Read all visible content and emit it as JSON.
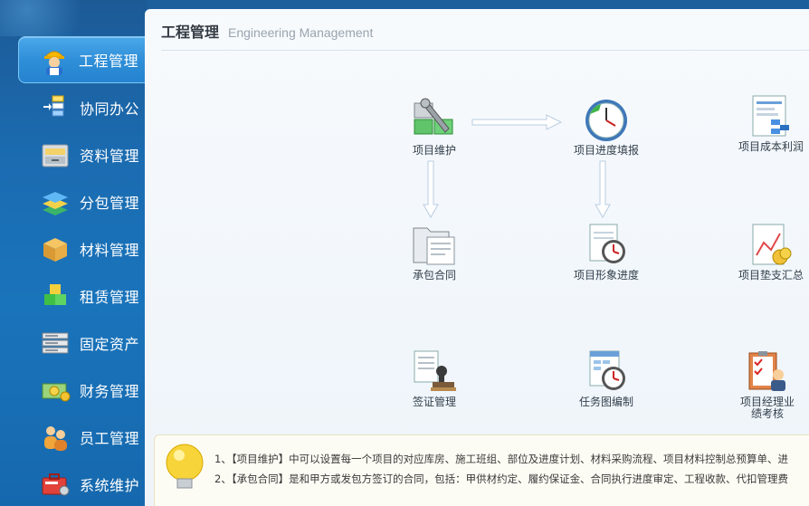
{
  "sidebar": {
    "items": [
      {
        "label": "工程管理",
        "icon": "worker-icon",
        "active": true
      },
      {
        "label": "协同办公",
        "icon": "collaboration-icon"
      },
      {
        "label": "资料管理",
        "icon": "archive-icon"
      },
      {
        "label": "分包管理",
        "icon": "subcontract-icon"
      },
      {
        "label": "材料管理",
        "icon": "box-icon"
      },
      {
        "label": "租赁管理",
        "icon": "cubes-icon"
      },
      {
        "label": "固定资产",
        "icon": "server-icon"
      },
      {
        "label": "财务管理",
        "icon": "money-icon"
      },
      {
        "label": "员工管理",
        "icon": "users-icon"
      },
      {
        "label": "系统维护",
        "icon": "toolbox-icon"
      }
    ]
  },
  "header": {
    "title": "工程管理",
    "subtitle": "Engineering Management"
  },
  "modules": {
    "project_maintenance": "项目维护",
    "progress_report": "项目进度填报",
    "cost_profit": "项目成本利润",
    "contract": "承包合同",
    "visual_progress": "项目形象进度",
    "advance_summary": "项目垫支汇总",
    "visa_management": "签证管理",
    "task_chart": "任务图编制",
    "manager_assessment_line1": "项目经理业",
    "manager_assessment_line2": "绩考核"
  },
  "footer": {
    "line1": "1、【项目维护】中可以设置每一个项目的对应库房、施工班组、部位及进度计划、材料采购流程、项目材料控制总预算单、进",
    "line2": "2、【承包合同】是和甲方或发包方签订的合同，包括：甲供材约定、履约保证金、合同执行进度审定、工程收款、代扣管理费"
  },
  "colors": {
    "sidebar_bg": "#1b6bb0",
    "active_bg": "#2f8fd8",
    "panel_bg": "#f4f8fc"
  }
}
